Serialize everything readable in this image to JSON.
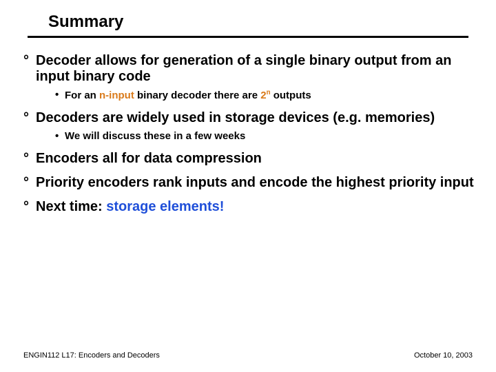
{
  "title": "Summary",
  "bullets": {
    "b1": {
      "mark": "°",
      "text": "Decoder allows for generation of a single binary output from an input binary code"
    },
    "b1_sub": {
      "mark": "•",
      "pre": "For an ",
      "hl1": "n-input",
      "mid": " binary decoder there are ",
      "hl2_base": "2",
      "hl2_sup": "n",
      "post": " outputs"
    },
    "b2": {
      "mark": "°",
      "text": "Decoders are widely used in storage devices (e.g. memories)"
    },
    "b2_sub": {
      "mark": "•",
      "text": "We will discuss these in a few weeks"
    },
    "b3": {
      "mark": "°",
      "text": "Encoders all for data compression"
    },
    "b4": {
      "mark": "°",
      "text": "Priority encoders rank inputs and encode the highest priority input"
    },
    "b5": {
      "mark": "°",
      "pre": "Next time: ",
      "hl": "storage elements!"
    }
  },
  "footer": {
    "left": "ENGIN112 L17: Encoders and Decoders",
    "right": "October 10, 2003"
  }
}
